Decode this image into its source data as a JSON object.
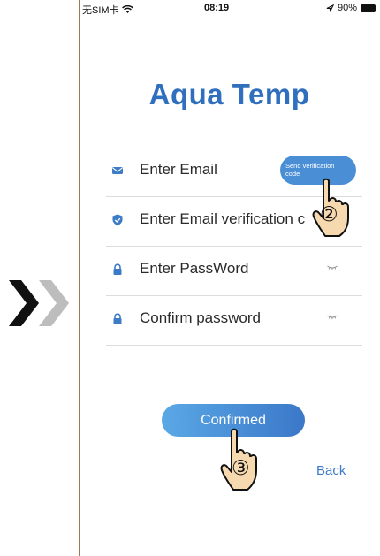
{
  "status_bar": {
    "carrier": "无SIM卡",
    "time": "08:19",
    "battery": "90%"
  },
  "app_title": "Aqua Temp",
  "form": {
    "email": {
      "placeholder": "Enter Email"
    },
    "send_code": {
      "label_line1": "Send verification",
      "label_line2": "code"
    },
    "verification": {
      "placeholder": "Enter Email verification c"
    },
    "password": {
      "placeholder": "Enter PassWord"
    },
    "confirm_password": {
      "placeholder": "Confirm password"
    }
  },
  "confirm_button": "Confirmed",
  "back_link": "Back",
  "annotations": {
    "step_2": "②",
    "step_3": "③"
  },
  "colors": {
    "accent": "#2f6fbd",
    "button": "#4a8fd6",
    "divider": "#dcdcdc"
  },
  "icons": [
    "wifi-icon",
    "location-arrow-icon",
    "battery-icon",
    "envelope-icon",
    "shield-check-icon",
    "lock-icon",
    "eye-closed-icon",
    "double-chevron-right-icon",
    "pointing-hand-icon"
  ]
}
